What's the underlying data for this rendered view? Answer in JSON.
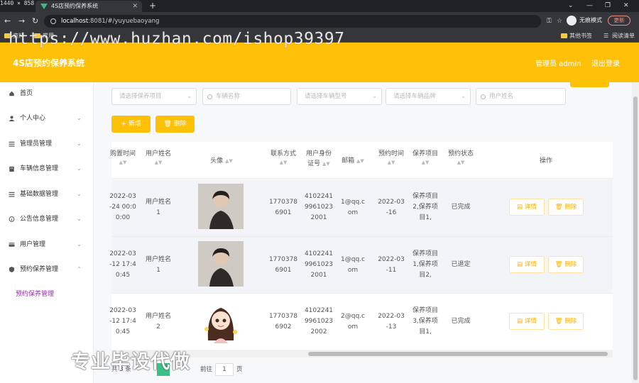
{
  "window": {
    "size_label": "1440 × 858"
  },
  "browser": {
    "tab_title": "4S店预约保养系统",
    "url_host": "localhost",
    "url_rest": ":8081/#/yuyuebaoyang",
    "incognito": "无痕模式",
    "update": "更新",
    "bookmarks": [
      "资料",
      "常用",
      "其他书签",
      "阅读清单"
    ]
  },
  "watermarks": {
    "url": "https://www.huzhan.com/ishop39397",
    "text": "专业毕设代做"
  },
  "header": {
    "title": "4S店预约保养系统",
    "user": "管理员 admin",
    "logout": "退出登录"
  },
  "sidebar": {
    "items": [
      {
        "label": "首页"
      },
      {
        "label": "个人中心"
      },
      {
        "label": "管理员管理"
      },
      {
        "label": "车辆信息管理"
      },
      {
        "label": "基础数据管理"
      },
      {
        "label": "公告信息管理"
      },
      {
        "label": "用户管理"
      },
      {
        "label": "预约保养管理"
      }
    ],
    "sub_item": "预约保养管理"
  },
  "filters": {
    "project": "请选择保养项目",
    "vehicle_name": "车辆名称",
    "vehicle_type": "请选择车辆型号",
    "vehicle_brand": "请选择车辆品牌",
    "user_name": "用户姓名"
  },
  "actions": {
    "add": "+ 新增",
    "delete": "删除"
  },
  "table": {
    "columns": [
      "购置时间",
      "用户姓名",
      "头像",
      "联系方式",
      "用户身份证号",
      "邮箱",
      "预约时间",
      "保养项目",
      "预约状态",
      "操作"
    ],
    "column_lines": {
      "purchase_time": "购置时间",
      "id_card_1": "用户身份",
      "id_card_2": "证号"
    },
    "rows": [
      {
        "purchase": [
          "2022-03",
          "-24 00:0",
          "0:00"
        ],
        "user": [
          "用户姓名",
          "1"
        ],
        "phone": [
          "1770378",
          "6901"
        ],
        "idcard": [
          "4102241",
          "9961023",
          "2001"
        ],
        "email": [
          "1@qq.c",
          "om"
        ],
        "date": [
          "2022-03",
          "-16"
        ],
        "project": [
          "保养项目",
          "2,保养项",
          "目1,"
        ],
        "status": "已完成"
      },
      {
        "purchase": [
          "2022-03",
          "-12 17:4",
          "0:45"
        ],
        "user": [
          "用户姓名",
          "1"
        ],
        "phone": [
          "1770378",
          "6901"
        ],
        "idcard": [
          "4102241",
          "9961023",
          "2001"
        ],
        "email": [
          "1@qq.c",
          "om"
        ],
        "date": [
          "2022-03",
          "-11"
        ],
        "project": [
          "保养项目",
          "1,保养项",
          "目2,"
        ],
        "status": "已退定"
      },
      {
        "purchase": [
          "2022-03",
          "-12 17:4",
          "0:45"
        ],
        "user": [
          "用户姓名",
          "2"
        ],
        "phone": [
          "1770378",
          "6902"
        ],
        "idcard": [
          "4102241",
          "9961023",
          "2002"
        ],
        "email": [
          "2@qq.c",
          "om"
        ],
        "date": [
          "2022-03",
          "-13"
        ],
        "project": [
          "保养项目",
          "3,保养项",
          "目1,"
        ],
        "status": "已完成"
      }
    ],
    "detail_label": "详情",
    "delete_label": "删除"
  },
  "pager": {
    "total": "共 3 条",
    "goto": "前往",
    "page_value": "1",
    "unit": "页"
  }
}
